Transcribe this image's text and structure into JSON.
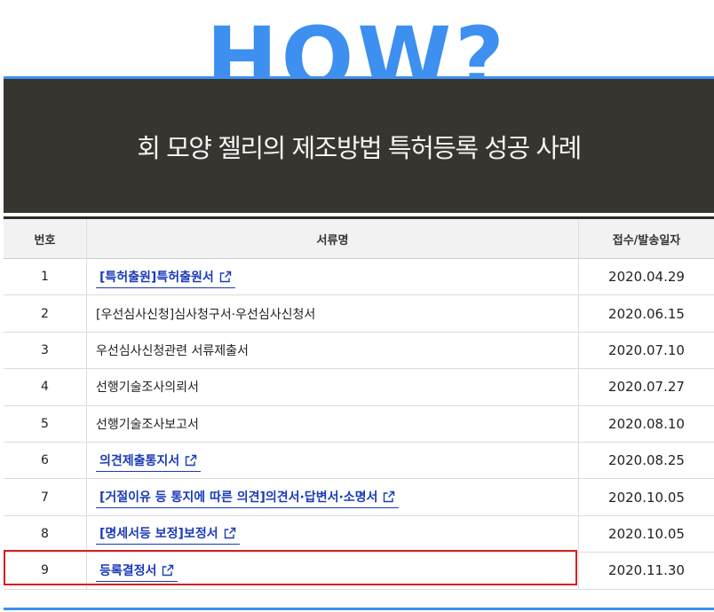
{
  "header": {
    "how_text": "HOW?",
    "banner_title": "회 모양 젤리의 제조방법 특허등록 성공 사례"
  },
  "table": {
    "headers": {
      "no": "번호",
      "name": "서류명",
      "date": "접수/발송일자"
    },
    "rows": [
      {
        "no": "1",
        "name": "[특허출원]특허출원서",
        "date": "2020.04.29",
        "link": true
      },
      {
        "no": "2",
        "name": "[우선심사신청]심사청구서·우선심사신청서",
        "date": "2020.06.15",
        "link": false
      },
      {
        "no": "3",
        "name": "우선심사신청관련 서류제출서",
        "date": "2020.07.10",
        "link": false
      },
      {
        "no": "4",
        "name": "선행기술조사의뢰서",
        "date": "2020.07.27",
        "link": false
      },
      {
        "no": "5",
        "name": "선행기술조사보고서",
        "date": "2020.08.10",
        "link": false
      },
      {
        "no": "6",
        "name": "의견제출통지서",
        "date": "2020.08.25",
        "link": true
      },
      {
        "no": "7",
        "name": "[거절이유 등 통지에 따른 의견]의견서·답변서·소명서",
        "date": "2020.10.05",
        "link": true
      },
      {
        "no": "8",
        "name": "[명세서등 보정]보정서",
        "date": "2020.10.05",
        "link": true
      },
      {
        "no": "9",
        "name": "등록결정서",
        "date": "2020.11.30",
        "link": true
      }
    ]
  },
  "colors": {
    "accent_blue": "#3d8ff0",
    "banner_bg": "#38342f",
    "link": "#1a3bb8",
    "highlight": "#d32020"
  },
  "icons": {
    "external_link": "external-link-icon"
  }
}
